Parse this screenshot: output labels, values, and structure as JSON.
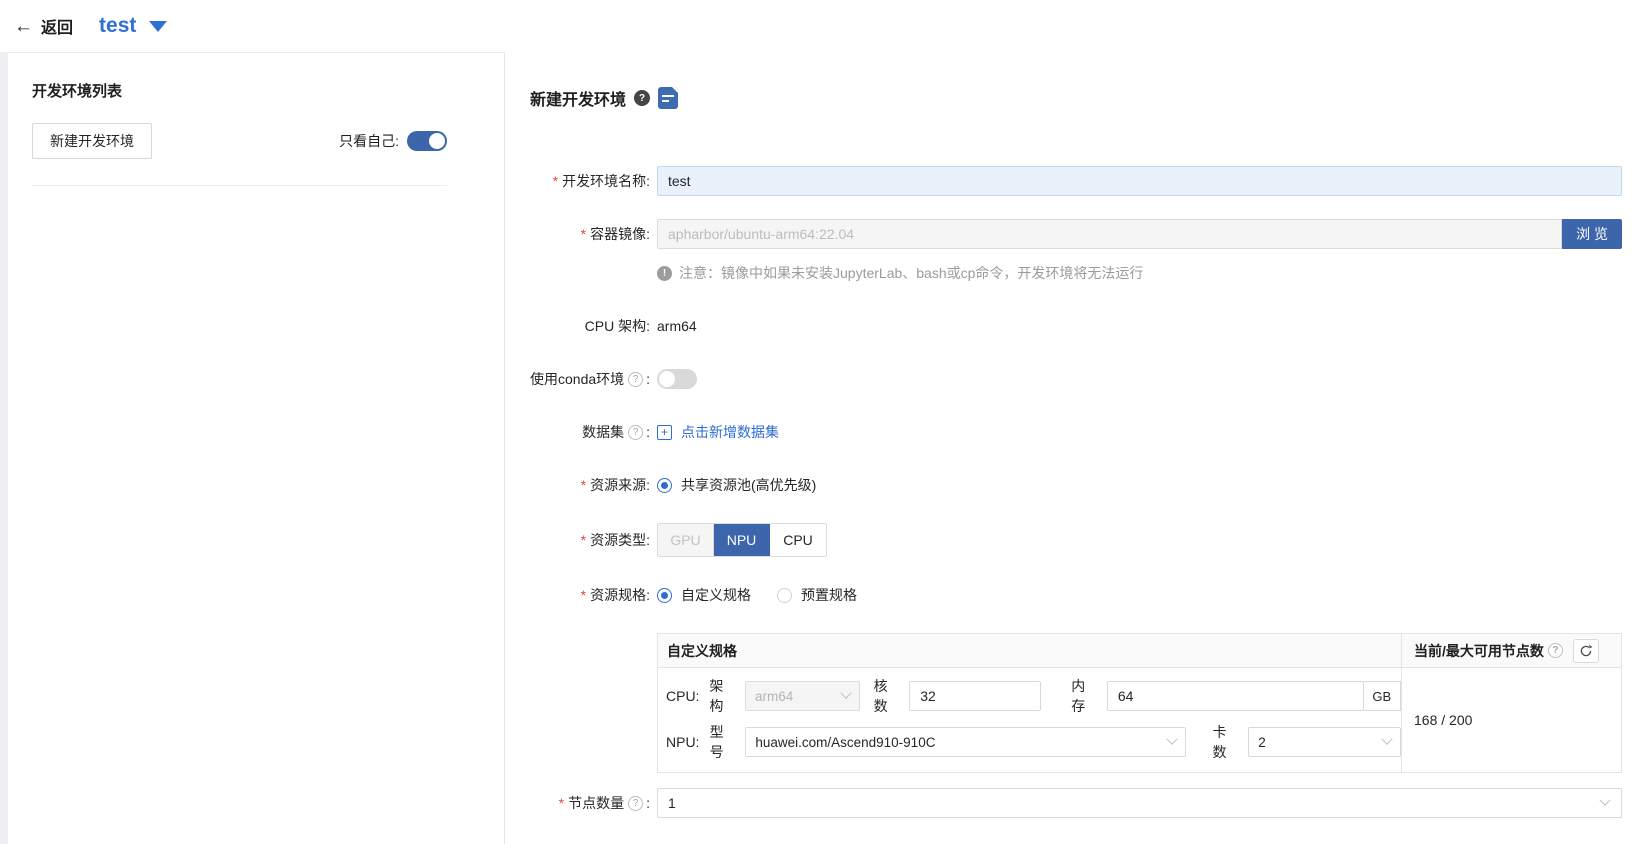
{
  "ui": {
    "colon": ":",
    "required_mark": "*",
    "help_glyph": "?",
    "info_glyph": "!",
    "plus_glyph": "+",
    "back_arrow": "←"
  },
  "header": {
    "back": "返回",
    "title": "test"
  },
  "left_panel": {
    "title": "开发环境列表",
    "new_env_button": "新建开发环境",
    "only_mine_label": "只看自己:",
    "only_mine_on": true
  },
  "panel": {
    "title": "新建开发环境"
  },
  "fields": {
    "name": {
      "label": "开发环境名称",
      "value": "test"
    },
    "image": {
      "label": "容器镜像",
      "placeholder": "apharbor/ubuntu-arm64:22.04",
      "browse": "浏 览",
      "note": "注意：镜像中如果未安装JupyterLab、bash或cp命令，开发环境将无法运行"
    },
    "cpu_arch": {
      "label": "CPU 架构:",
      "value": "arm64"
    },
    "conda": {
      "label": "使用conda环境",
      "enabled": false
    },
    "dataset": {
      "label": "数据集",
      "add_link": "点击新增数据集"
    },
    "resource_source": {
      "label": "资源来源",
      "option": "共享资源池(高优先级)",
      "selected": true
    },
    "resource_type": {
      "label": "资源类型",
      "options": [
        {
          "label": "GPU",
          "state": "disabled"
        },
        {
          "label": "NPU",
          "state": "selected"
        },
        {
          "label": "CPU",
          "state": "normal"
        }
      ]
    },
    "resource_spec": {
      "label": "资源规格",
      "options": [
        {
          "label": "自定义规格",
          "selected": true
        },
        {
          "label": "预置规格",
          "selected": false
        }
      ]
    },
    "node_count": {
      "label": "节点数量",
      "value": "1"
    }
  },
  "spec_table": {
    "header_left": "自定义规格",
    "header_right": "当前/最大可用节点数",
    "availability": "168 / 200",
    "cpu_row": {
      "prefix": "CPU:",
      "arch_label": "架构",
      "arch_value": "arm64",
      "cores_label": "核数",
      "cores_value": "32",
      "mem_label": "内存",
      "mem_value": "64",
      "mem_unit": "GB"
    },
    "npu_row": {
      "prefix": "NPU:",
      "model_label": "型号",
      "model_value": "huawei.com/Ascend910-910C",
      "cards_label": "卡数",
      "cards_value": "2"
    }
  },
  "colors": {
    "primary": "#3d65ab",
    "link": "#2d6cd2",
    "title_blue": "#2f6fd6"
  }
}
